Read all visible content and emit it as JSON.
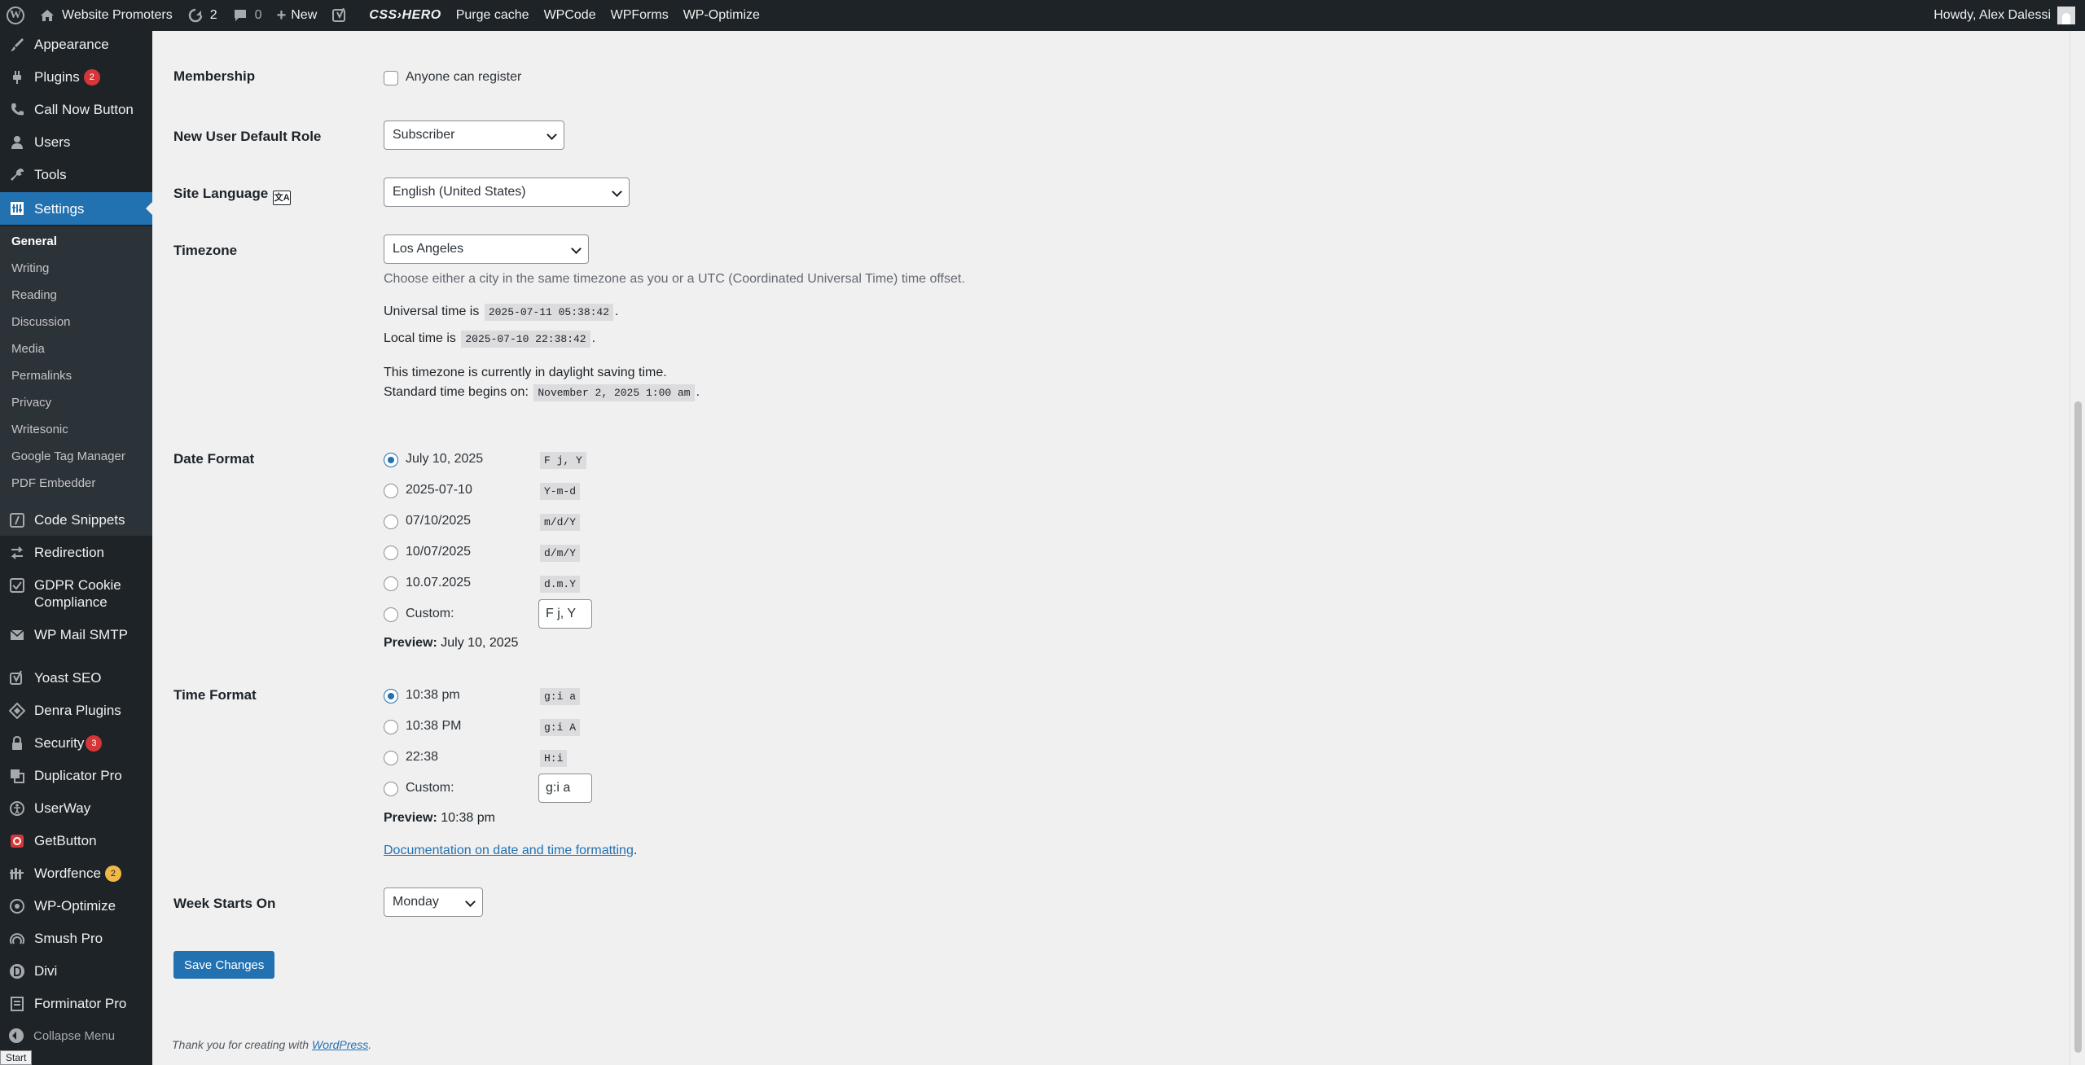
{
  "admin_bar": {
    "site_name": "Website Promoters",
    "updates_count": "2",
    "comments_count": "0",
    "new_label": "New",
    "css_hero": "CSS›HERO",
    "purge_cache": "Purge cache",
    "wpcode": "WPCode",
    "wpforms": "WPForms",
    "wp_optimize": "WP-Optimize",
    "howdy": "Howdy, Alex Dalessi"
  },
  "sidebar": {
    "appearance": "Appearance",
    "plugins": "Plugins",
    "plugins_badge": "2",
    "call_now_button": "Call Now Button",
    "users": "Users",
    "tools": "Tools",
    "settings": "Settings",
    "submenu": [
      "General",
      "Writing",
      "Reading",
      "Discussion",
      "Media",
      "Permalinks",
      "Privacy",
      "Writesonic",
      "Google Tag Manager",
      "PDF Embedder"
    ],
    "code_snippets": "Code Snippets",
    "redirection": "Redirection",
    "gdpr_line1": "GDPR Cookie",
    "gdpr_line2": "Compliance",
    "wp_mail_smtp": "WP Mail SMTP",
    "yoast_seo": "Yoast SEO",
    "denra_plugins": "Denra Plugins",
    "security": "Security",
    "security_badge": "3",
    "duplicator_pro": "Duplicator Pro",
    "userway": "UserWay",
    "getbutton": "GetButton",
    "wordfence": "Wordfence",
    "wordfence_badge": "2",
    "wp_optimize": "WP-Optimize",
    "smush_pro": "Smush Pro",
    "divi": "Divi",
    "forminator_pro": "Forminator Pro",
    "collapse_menu": "Collapse Menu",
    "start": "Start"
  },
  "settings": {
    "membership_label": "Membership",
    "anyone_can_register": "Anyone can register",
    "default_role_label": "New User Default Role",
    "default_role_value": "Subscriber",
    "site_language_label": "Site Language",
    "site_language_value": "English (United States)",
    "timezone_label": "Timezone",
    "timezone_value": "Los Angeles",
    "timezone_desc": "Choose either a city in the same timezone as you or a UTC (Coordinated Universal Time) time offset.",
    "universal_time_prefix": "Universal time is",
    "universal_time": "2025-07-11 05:38:42",
    "local_time_prefix": "Local time is",
    "local_time": "2025-07-10 22:38:42",
    "dst_text": "This timezone is currently in daylight saving time.",
    "standard_time_prefix": "Standard time begins on:",
    "standard_time": "November 2, 2025 1:00 am",
    "date_format_label": "Date Format",
    "date_options": [
      {
        "label": "July 10, 2025",
        "format": "F j, Y"
      },
      {
        "label": "2025-07-10",
        "format": "Y-m-d"
      },
      {
        "label": "07/10/2025",
        "format": "m/d/Y"
      },
      {
        "label": "10/07/2025",
        "format": "d/m/Y"
      },
      {
        "label": "10.07.2025",
        "format": "d.m.Y"
      }
    ],
    "custom_label": "Custom:",
    "date_custom_value": "F j, Y",
    "preview_label": "Preview:",
    "date_preview": "July 10, 2025",
    "time_format_label": "Time Format",
    "time_options": [
      {
        "label": "10:38 pm",
        "format": "g:i a"
      },
      {
        "label": "10:38 PM",
        "format": "g:i A"
      },
      {
        "label": "22:38",
        "format": "H:i"
      }
    ],
    "time_custom_value": "g:i a",
    "time_preview": "10:38 pm",
    "doc_link": "Documentation on date and time formatting",
    "week_starts_label": "Week Starts On",
    "week_starts_value": "Monday",
    "save_button": "Save Changes",
    "footer_prefix": "Thank you for creating with",
    "footer_link": "WordPress"
  }
}
